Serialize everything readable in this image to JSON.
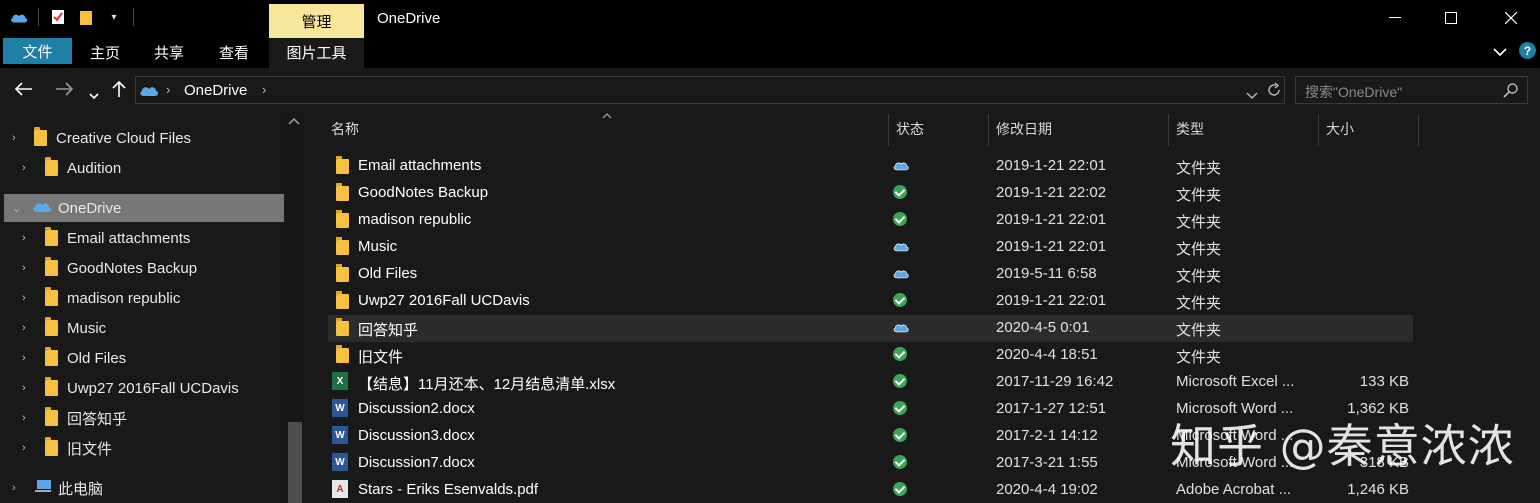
{
  "titlebar": {
    "manage_tab": "管理",
    "title": "OneDrive",
    "minimize": "—",
    "maximize": "☐",
    "close": "✕"
  },
  "ribbon": {
    "tabs": [
      "文件",
      "主页",
      "共享",
      "查看",
      "图片工具"
    ],
    "expand": "⌄",
    "help": "?"
  },
  "address": {
    "back": "←",
    "forward": "→",
    "recent": "⌄",
    "up": "↑",
    "path": "OneDrive",
    "search_placeholder": "搜索\"OneDrive\""
  },
  "sidebar": {
    "items": [
      {
        "label": "Creative Cloud Files"
      },
      {
        "label": "Audition"
      },
      {
        "label": "OneDrive"
      },
      {
        "label": "Email attachments"
      },
      {
        "label": "GoodNotes Backup"
      },
      {
        "label": "madison republic"
      },
      {
        "label": "Music"
      },
      {
        "label": "Old Files"
      },
      {
        "label": "Uwp27 2016Fall UCDavis"
      },
      {
        "label": "回答知乎"
      },
      {
        "label": "旧文件"
      },
      {
        "label": "此电脑"
      }
    ]
  },
  "columns": {
    "name": "名称",
    "status": "状态",
    "date": "修改日期",
    "type": "类型",
    "size": "大小"
  },
  "files": [
    {
      "name": "Email attachments",
      "status": "cloud",
      "date": "2019-1-21 22:01",
      "type": "文件夹",
      "size": "",
      "kind": "folder"
    },
    {
      "name": "GoodNotes Backup",
      "status": "ok",
      "date": "2019-1-21 22:02",
      "type": "文件夹",
      "size": "",
      "kind": "folder"
    },
    {
      "name": "madison republic",
      "status": "ok",
      "date": "2019-1-21 22:01",
      "type": "文件夹",
      "size": "",
      "kind": "folder"
    },
    {
      "name": "Music",
      "status": "cloud",
      "date": "2019-1-21 22:01",
      "type": "文件夹",
      "size": "",
      "kind": "folder"
    },
    {
      "name": "Old Files",
      "status": "cloud",
      "date": "2019-5-11 6:58",
      "type": "文件夹",
      "size": "",
      "kind": "folder"
    },
    {
      "name": "Uwp27 2016Fall UCDavis",
      "status": "ok",
      "date": "2019-1-21 22:01",
      "type": "文件夹",
      "size": "",
      "kind": "folder"
    },
    {
      "name": "回答知乎",
      "status": "cloud",
      "date": "2020-4-5 0:01",
      "type": "文件夹",
      "size": "",
      "kind": "folder"
    },
    {
      "name": "旧文件",
      "status": "ok",
      "date": "2020-4-4 18:51",
      "type": "文件夹",
      "size": "",
      "kind": "folder"
    },
    {
      "name": "【结息】11月还本、12月结息清单.xlsx",
      "status": "ok",
      "date": "2017-11-29 16:42",
      "type": "Microsoft Excel ...",
      "size": "133 KB",
      "kind": "excel"
    },
    {
      "name": "Discussion2.docx",
      "status": "ok",
      "date": "2017-1-27 12:51",
      "type": "Microsoft Word ...",
      "size": "1,362 KB",
      "kind": "word"
    },
    {
      "name": "Discussion3.docx",
      "status": "ok",
      "date": "2017-2-1 14:12",
      "type": "Microsoft Word ...",
      "size": "",
      "kind": "word"
    },
    {
      "name": "Discussion7.docx",
      "status": "ok",
      "date": "2017-3-21 1:55",
      "type": "Microsoft Word ...",
      "size": "318 KB",
      "kind": "word"
    },
    {
      "name": "Stars - Eriks Esenvalds.pdf",
      "status": "ok",
      "date": "2020-4-4 19:02",
      "type": "Adobe Acrobat ...",
      "size": "1,246 KB",
      "kind": "pdf"
    }
  ],
  "watermark": "知乎 @秦意浓浓",
  "colors": {
    "accent": "#1f7ea3",
    "manage_tab": "#f7e79b",
    "folder": "#f6c143",
    "status_ok": "#3aa655",
    "cloud": "#5ba7e8"
  }
}
